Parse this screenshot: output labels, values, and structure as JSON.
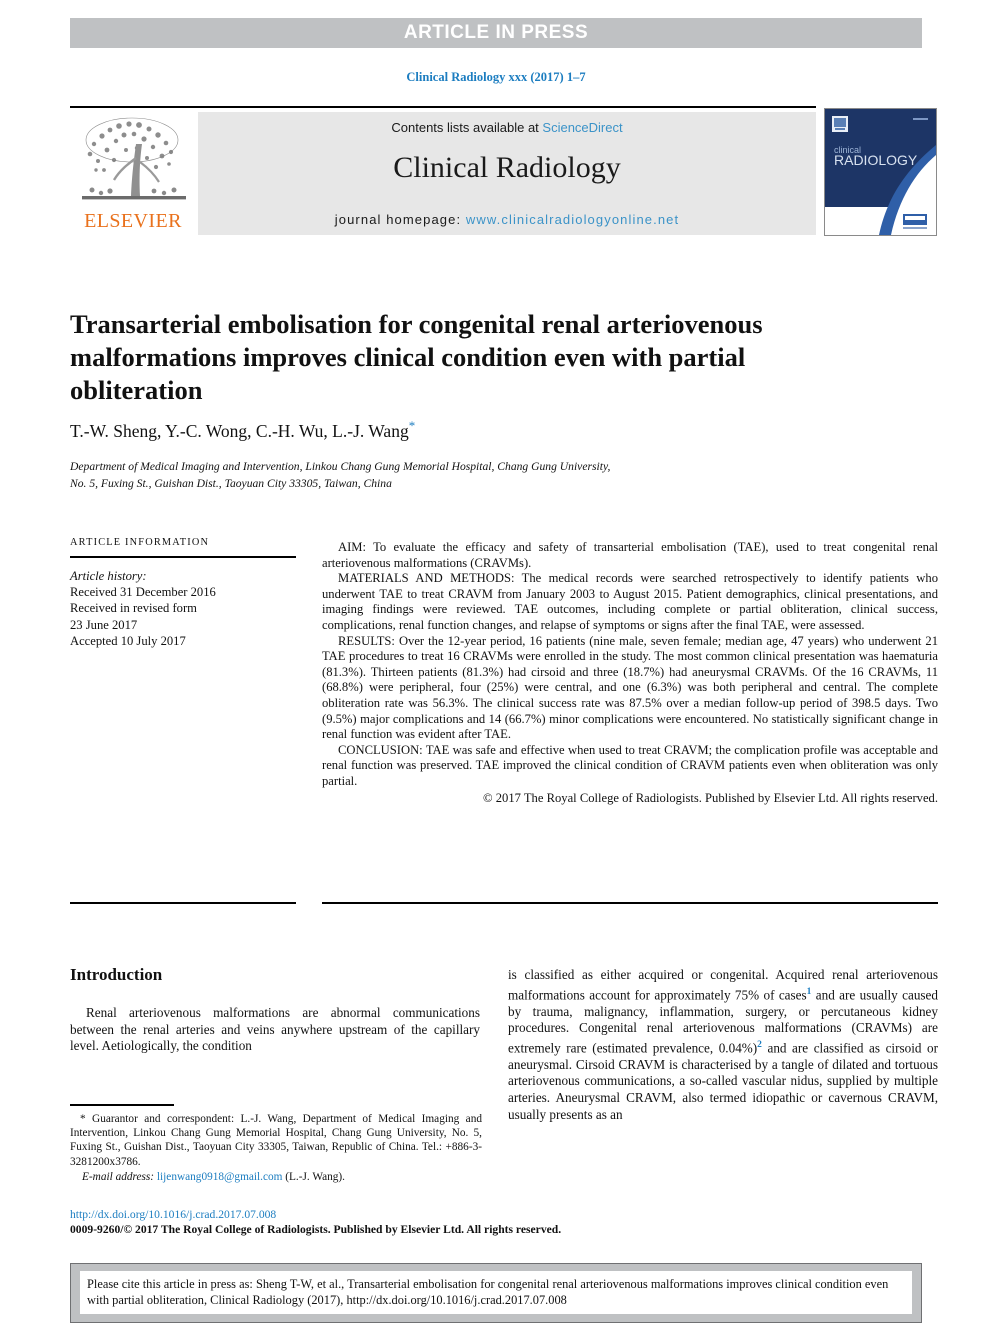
{
  "banner": {
    "text": "ARTICLE IN PRESS"
  },
  "running_head": {
    "text": "Clinical Radiology xxx (2017) 1–7",
    "color": "#1c7dc0"
  },
  "masthead": {
    "contents_prefix": "Contents lists available at ",
    "sciencedirect": "ScienceDirect",
    "journal_title": "Clinical Radiology",
    "homepage_label": "journal homepage: ",
    "homepage_url": "www.clinicalradiologyonline.net",
    "publisher_logo_text": "ELSEVIER",
    "publisher_logo_color": "#E9711C",
    "link_color": "#3b93c8",
    "box_background": "#e7e7e7",
    "cover_title_line1": "clinical",
    "cover_title_line2": "RADIOLOGY"
  },
  "article": {
    "title": "Transarterial embolisation for congenital renal arteriovenous malformations improves clinical condition even with partial obliteration",
    "authors": "T.-W. Sheng, Y.-C. Wong, C.-H. Wu, L.-J. Wang",
    "corresponding_marker": "*",
    "affiliation_line1": "Department of Medical Imaging and Intervention, Linkou Chang Gung Memorial Hospital, Chang Gung University,",
    "affiliation_line2": "No. 5, Fuxing St., Guishan Dist., Taoyuan City 33305, Taiwan, China"
  },
  "article_information": {
    "heading": "ARTICLE INFORMATION",
    "history_label": "Article history:",
    "received": "Received 31 December 2016",
    "revised_label": "Received in revised form",
    "revised_date": "23 June 2017",
    "accepted": "Accepted 10 July 2017"
  },
  "abstract": {
    "aim": "AIM: To evaluate the efficacy and safety of transarterial embolisation (TAE), used to treat congenital renal arteriovenous malformations (CRAVMs).",
    "materials_and_methods": "MATERIALS AND METHODS: The medical records were searched retrospectively to identify patients who underwent TAE to treat CRAVM from January 2003 to August 2015. Patient demographics, clinical presentations, and imaging findings were reviewed. TAE outcomes, including complete or partial obliteration, clinical success, complications, renal function changes, and relapse of symptoms or signs after the final TAE, were assessed.",
    "results": "RESULTS: Over the 12-year period, 16 patients (nine male, seven female; median age, 47 years) who underwent 21 TAE procedures to treat 16 CRAVMs were enrolled in the study. The most common clinical presentation was haematuria (81.3%). Thirteen patients (81.3%) had cirsoid and three (18.7%) had aneurysmal CRAVMs. Of the 16 CRAVMs, 11 (68.8%) were peripheral, four (25%) were central, and one (6.3%) was both peripheral and central. The complete obliteration rate was 56.3%. The clinical success rate was 87.5% over a median follow-up period of 398.5 days. Two (9.5%) major complications and 14 (66.7%) minor complications were encountered. No statistically significant change in renal function was evident after TAE.",
    "conclusion": "CONCLUSION: TAE was safe and effective when used to treat CRAVM; the complication profile was acceptable and renal function was preserved. TAE improved the clinical condition of CRAVM patients even when obliteration was only partial.",
    "copyright": "© 2017 The Royal College of Radiologists. Published by Elsevier Ltd. All rights reserved."
  },
  "introduction": {
    "heading": "Introduction",
    "left_paragraph": "Renal arteriovenous malformations are abnormal communications between the renal arteries and veins anywhere upstream of the capillary level. Aetiologically, the condition",
    "right_part1": "is classified as either acquired or congenital. Acquired renal arteriovenous malformations account for approximately 75% of cases",
    "right_ref1": "1",
    "right_part2": " and are usually caused by trauma, malignancy, inflammation, surgery, or percutaneous kidney procedures. Congenital renal arteriovenous malformations (CRAVMs) are extremely rare (estimated prevalence, 0.04%)",
    "right_ref2": "2",
    "right_part3": " and are classified as cirsoid or aneurysmal. Cirsoid CRAVM is characterised by a tangle of dilated and tortuous arteriovenous communications, a so-called vascular nidus, supplied by multiple arteries. Aneurysmal CRAVM, also termed idiopathic or cavernous CRAVM, usually presents as an"
  },
  "footnote": {
    "correspondence": "* Guarantor and correspondent: L.-J. Wang, Department of Medical Imaging and Intervention, Linkou Chang Gung Memorial Hospital, Chang Gung University, No. 5, Fuxing St., Guishan Dist., Taoyuan City 33305, Taiwan, Republic of China. Tel.: +886-3-3281200x3786.",
    "email_label": "E-mail address: ",
    "email": "lijenwang0918@gmail.com",
    "email_suffix": " (L.-J. Wang).",
    "doi_url": "http://dx.doi.org/10.1016/j.crad.2017.07.008",
    "copyright_statement": "0009-9260/© 2017 The Royal College of Radiologists. Published by Elsevier Ltd. All rights reserved."
  },
  "cite_box": {
    "text": "Please cite this article in press as: Sheng T-W, et al., Transarterial embolisation for congenital renal arteriovenous malformations improves clinical condition even with partial obliteration, Clinical Radiology (2017), http://dx.doi.org/10.1016/j.crad.2017.07.008"
  }
}
